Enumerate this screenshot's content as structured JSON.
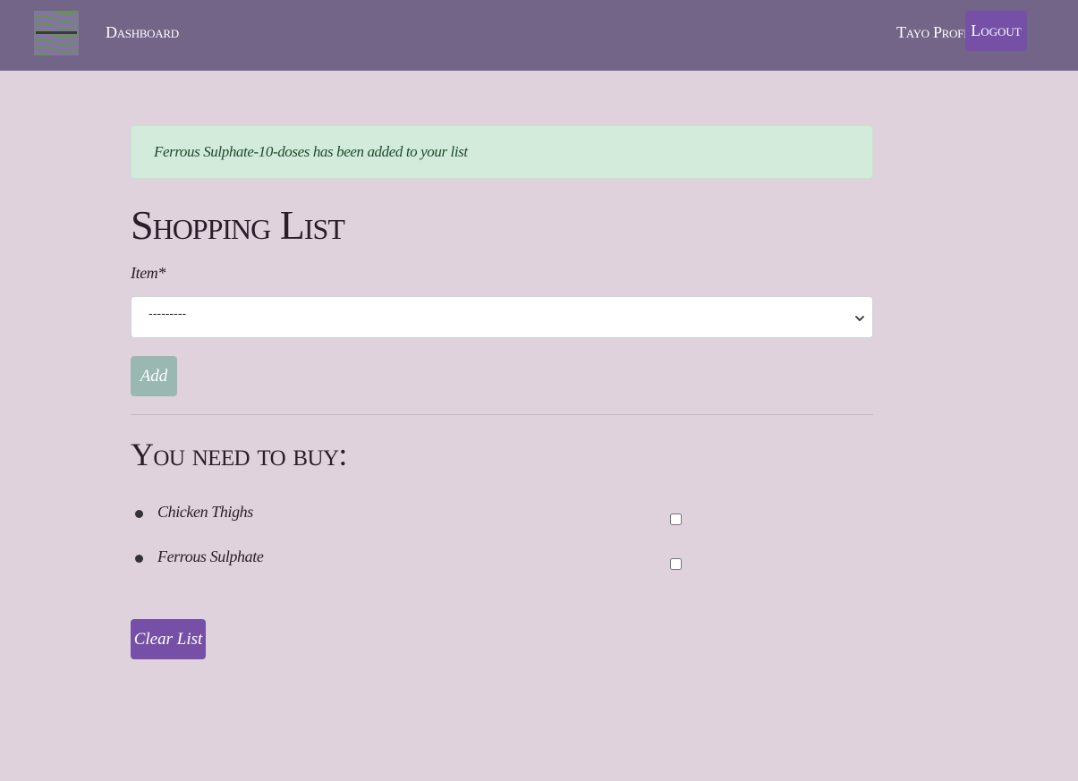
{
  "navbar": {
    "logo_icon": "swirl-logo-icon",
    "dashboard_label": "Dashboard",
    "profile_label": "Tayo Profile",
    "logout_label": "Logout",
    "bg_color": "#726588",
    "accent_color": "#7550a6"
  },
  "alert": {
    "message": "Ferrous Sulphate-10-doses has been added to your list",
    "bg_color": "#d3ebdb"
  },
  "main": {
    "title": "Shopping List",
    "item_field": {
      "label": "Item*",
      "selected_value": "---------",
      "chevron_icon": "chevron-down-icon"
    },
    "add_label": "Add",
    "list_title": "You need to buy:",
    "items": [
      {
        "label": "Chicken Thighs",
        "checked": false
      },
      {
        "label": "Ferrous Sulphate",
        "checked": false
      }
    ],
    "clear_label": "Clear List"
  }
}
